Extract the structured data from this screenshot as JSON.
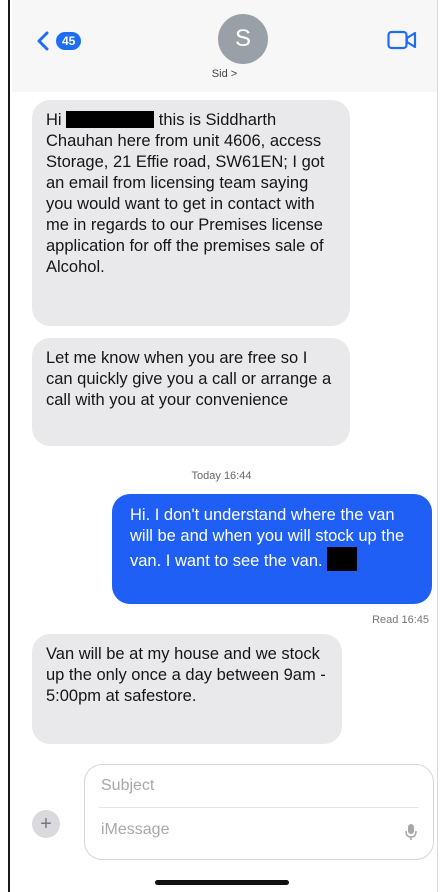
{
  "header": {
    "back_badge": "45",
    "avatar_initial": "S",
    "contact_name": "Sid >"
  },
  "messages": {
    "m1": {
      "line1_a": "Hi",
      "line1_b": "this is Siddharth",
      "rest": "Chauhan here from unit 4606, access Storage, 21 Effie road, SW61EN; I got an email from licensing team saying you would want to get in contact with me in regards to our Premises license application for off the premises sale of Alcohol."
    },
    "m2": "Let me know when you are free so I can quickly give you a call or arrange a call with you at your convenience",
    "timestamp": "Today 16:44",
    "m3_main": "Hi.  I don't understand where the van will be and when you will stock up the van. I want to see the van.",
    "read_receipt": "Read 16:45",
    "m4": "Van will be at my house and we stock up the only once a day between 9am - 5:00pm at safestore."
  },
  "composer": {
    "subject_placeholder": "Subject",
    "message_placeholder": "iMessage",
    "plus": "+"
  },
  "colors": {
    "incoming_bubble": "#e9e9eb",
    "outgoing_bubble": "#1f5ff5",
    "badge": "#1d6ef5"
  }
}
